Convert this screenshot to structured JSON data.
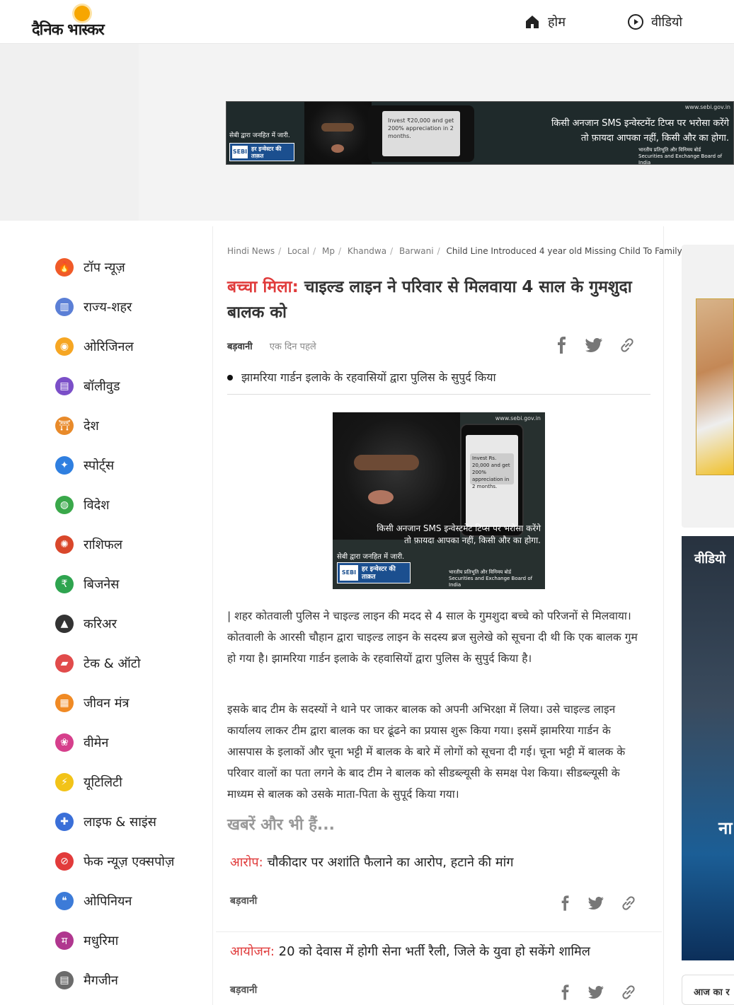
{
  "brand": {
    "logo_text": "दैनिक भास्कर"
  },
  "nav": {
    "home_label": "होम",
    "video_label": "वीडियो"
  },
  "ad_banner": {
    "url": "www.sebi.gov.in",
    "sms": "Invest ₹20,000 and get 200% appreciation in 2 months.",
    "message_line1": "किसी अनजान SMS इन्वेस्टमेंट टिप्स पर भरोसा करेंगे",
    "message_line2": "तो फ़ायदा आपका नहीं, किसी और का होगा.",
    "gov_text": "सेबी द्वारा जनहित में जारी.",
    "badge_logo": "SEBI",
    "badge_tag": "हर इन्वेस्टर की ताक़त",
    "org_hi": "भारतीय प्रतिभूति और विनिमय बोर्ड",
    "org_en": "Securities and Exchange Board of India"
  },
  "sidebar": {
    "items": [
      {
        "label": "टॉप न्यूज़",
        "icon": "fire-icon",
        "color": "#f05a28"
      },
      {
        "label": "राज्य-शहर",
        "icon": "city-icon",
        "color": "#5b7fd6"
      },
      {
        "label": "ओरिजिनल",
        "icon": "lamp-icon",
        "color": "#f6a623"
      },
      {
        "label": "बॉलीवुड",
        "icon": "clapper-icon",
        "color": "#7b4fc8"
      },
      {
        "label": "देश",
        "icon": "gate-icon",
        "color": "#e88a2a"
      },
      {
        "label": "स्पोर्ट्स",
        "icon": "runner-icon",
        "color": "#2f7fe0"
      },
      {
        "label": "विदेश",
        "icon": "globe-icon",
        "color": "#3aa84a"
      },
      {
        "label": "राशिफल",
        "icon": "zodiac-icon",
        "color": "#d9472b"
      },
      {
        "label": "बिजनेस",
        "icon": "rupee-icon",
        "color": "#2ea44f"
      },
      {
        "label": "करिअर",
        "icon": "graduation-icon",
        "color": "#333333"
      },
      {
        "label": "टेक & ऑटो",
        "icon": "car-icon",
        "color": "#e14b4b"
      },
      {
        "label": "जीवन मंत्र",
        "icon": "book-icon",
        "color": "#f08a24"
      },
      {
        "label": "वीमेन",
        "icon": "women-icon",
        "color": "#d63f8c"
      },
      {
        "label": "यूटिलिटी",
        "icon": "bulb-icon",
        "color": "#f2c318"
      },
      {
        "label": "लाइफ & साइंस",
        "icon": "dna-icon",
        "color": "#3a6fd8"
      },
      {
        "label": "फेक न्यूज़ एक्सपोज़",
        "icon": "fake-icon",
        "color": "#e23b3b"
      },
      {
        "label": "ओपिनियन",
        "icon": "quote-icon",
        "color": "#3c7bd8"
      },
      {
        "label": "मधुरिमा",
        "icon": "m-icon",
        "color": "#b0378f"
      },
      {
        "label": "मैगजीन",
        "icon": "magazine-icon",
        "color": "#6b6b6b"
      }
    ]
  },
  "breadcrumb": {
    "items": [
      "Hindi News",
      "Local",
      "Mp",
      "Khandwa",
      "Barwani"
    ],
    "current": "Child Line Introduced 4 year old Missing Child To Family"
  },
  "article": {
    "kicker": "बच्चा मिला:",
    "title": " चाइल्ड लाइन ने परिवार से मिलवाया 4 साल के गुमशुदा बालक को",
    "city": "बड़वानी",
    "time": "एक दिन पहले",
    "bullet": "झामरिया गार्डन इलाके के रहवासियों द्वारा पुलिस के सुपुर्द किया",
    "para1": "| शहर कोतवाली पुलिस ने चाइल्ड लाइन की मदद से 4 साल के गुमशुदा बच्चे को परिजनों से मिलवाया। कोतवाली के आरसी चौहान द्वारा चाइल्ड लाइन के सदस्य ब्रज सुलेखे को सूचना दी थी कि एक बालक गुम हो गया है। झामरिया गार्डन इलाके के रहवासियों द्वारा पुलिस के सुपुर्द किया है।",
    "para2": "इसके बाद टीम के सदस्यों ने थाने पर जाकर बालक को अपनी अभिरक्षा में लिया। उसे चाइल्ड लाइन कार्यालय लाकर टीम द्वारा बालक का घर ढूंढने का प्रयास शुरू किया गया। इसमें झामरिया गार्डन के आसपास के इलाकों और चूना भट्टी में बालक के बारे में लोगों को सूचना दी गई। चूना भट्टी में बालक के परिवार वालों का पता लगने के बाद टीम ने बालक को सीडब्ल्यूसी के समक्ष पेश किया। सीडब्ल्यूसी के माध्यम से बालक को उसके माता-पिता के सुपूर्द किया गया।"
  },
  "article_ad": {
    "url": "www.sebi.gov.in",
    "sms": "Invest Rs. 20,000 and get 200% appreciation in 2 months.",
    "message_line1": "किसी अनजान SMS इन्वेस्टमेंट टिप्स पर भरोसा करेंगे",
    "message_line2": "तो फ़ायदा आपका नहीं, किसी और का होगा.",
    "gov_text": "सेबी द्वारा जनहित में जारी.",
    "badge_logo": "SEBI",
    "badge_tag": "हर इन्वेस्टर की ताक़त",
    "org_hi": "भारतीय प्रतिभूति और विनिमय बोर्ड",
    "org_en": "Securities and Exchange Board of India"
  },
  "more_news": {
    "heading": "खबरें और भी हैं...",
    "items": [
      {
        "kicker": "आरोप:",
        "title": " चौकीदार पर अशांति फैलाने का आरोप, हटाने की मांग",
        "city": "बड़वानी"
      },
      {
        "kicker": "आयोजन:",
        "title": " 20 को देवास में होगी सेना भर्ती रैली, जिले के युवा हो सकेंगे शामिल",
        "city": "बड़वानी"
      }
    ]
  },
  "right_rail": {
    "video_label": "वीडियो",
    "video_text": "ना",
    "box_label": "आज का र"
  },
  "colors": {
    "accent_red": "#e03b3b",
    "brand_sun": "#f7a600"
  }
}
